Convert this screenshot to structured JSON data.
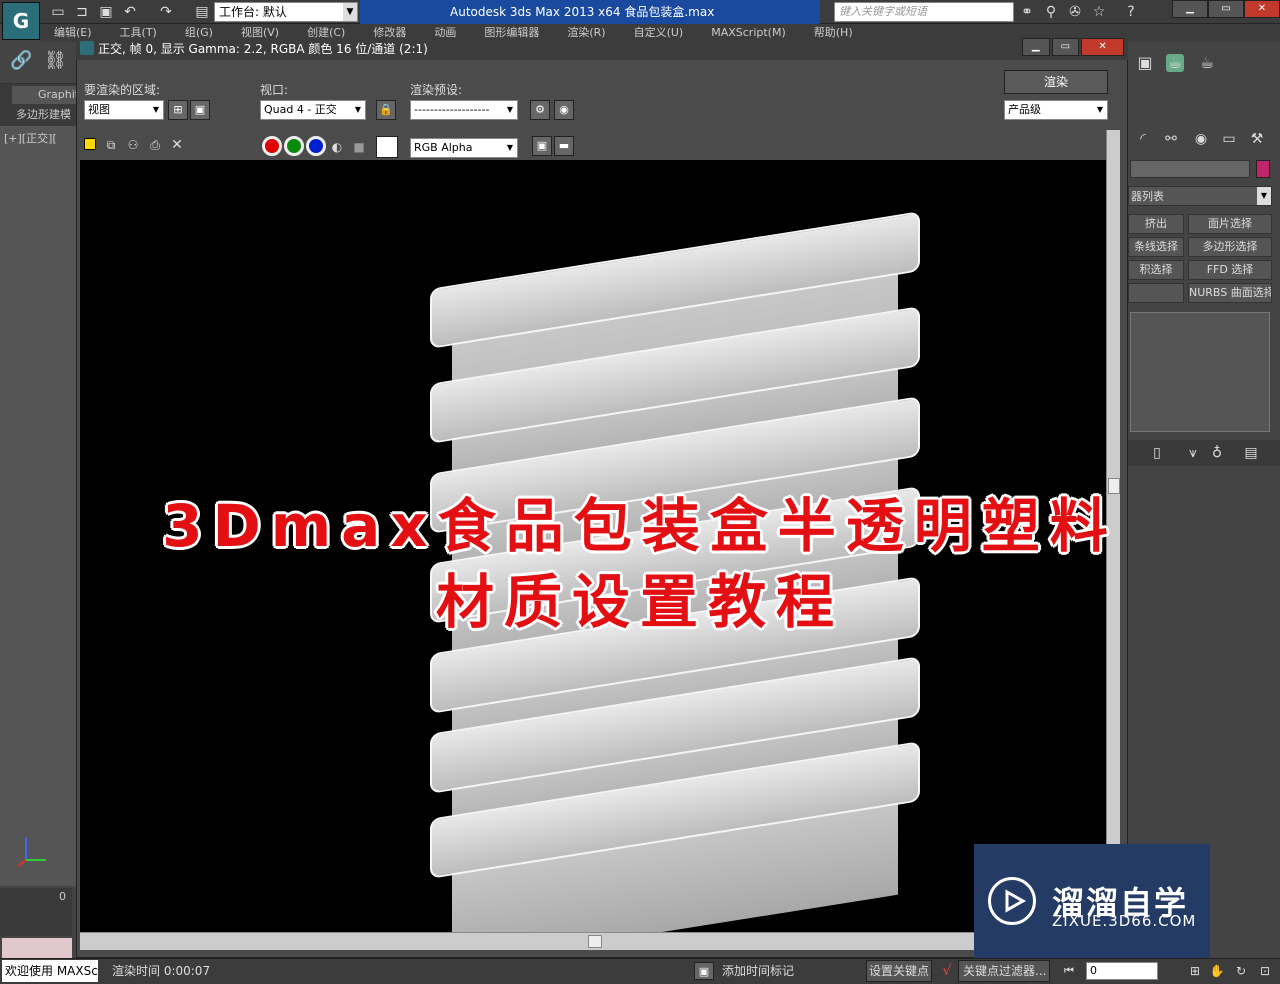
{
  "app": {
    "logo": "G",
    "title": "Autodesk 3ds Max  2013 x64      食品包装盒.max",
    "workspace": "工作台: 默认",
    "search_placeholder": "键入关键字或短语"
  },
  "menu": [
    "编辑(E)",
    "工具(T)",
    "组(G)",
    "视图(V)",
    "创建(C)",
    "修改器",
    "动画",
    "图形编辑器",
    "渲染(R)",
    "自定义(U)",
    "MAXScript(M)",
    "帮助(H)"
  ],
  "ribbon": {
    "graphite_tab": "Graphite",
    "poly_label": "多边形建模"
  },
  "viewport_label": "[+][正交][",
  "timeline_value": "0",
  "render_frame": {
    "title": "正交, 帧 0, 显示 Gamma: 2.2, RGBA 颜色 16 位/通道 (2:1)",
    "area_label": "要渲染的区域:",
    "area_value": "视图",
    "viewport_label": "视口:",
    "viewport_value": "Quad 4 - 正交",
    "preset_label": "渲染预设:",
    "preset_value": "-------------------",
    "render_button": "渲染",
    "quality_value": "产品级",
    "channel_value": "RGB Alpha"
  },
  "headline": {
    "line1": "3Dmax食品包装盒半透明塑料",
    "line2": "材质设置教程",
    "color": "#e30f12"
  },
  "command_panel": {
    "modifier_list": "器列表",
    "buttons": [
      [
        "挤出",
        "面片选择"
      ],
      [
        "条线选择",
        "多边形选择"
      ],
      [
        "积选择",
        "FFD 选择"
      ],
      [
        "",
        "NURBS 曲面选择"
      ]
    ]
  },
  "watermark": {
    "brand": "溜溜自学",
    "url": "ZIXUE.3D66.COM"
  },
  "status": {
    "welcome": "欢迎使用 MAXScr",
    "render_time": "渲染时间 0:00:07",
    "add_time_tag": "添加时间标记",
    "set_key": "设置关键点",
    "key_filter": "关键点过滤器...",
    "frame": "0"
  }
}
